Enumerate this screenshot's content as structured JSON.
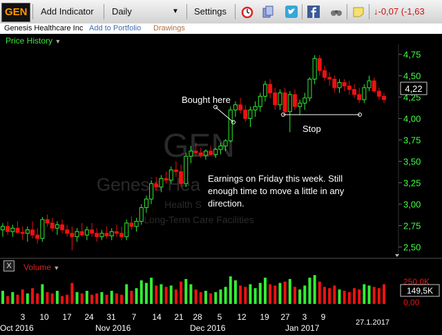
{
  "toolbar": {
    "symbol": "GEN",
    "add_indicator": "Add Indicator",
    "interval": "Daily",
    "interval_arrow": "▼",
    "settings": "Settings",
    "change": "↓-0,07 (-1,63"
  },
  "subbar": {
    "company": "Genesis Healthcare Inc",
    "add_portfolio": "Add to Portfolio",
    "drawings": "Drawings"
  },
  "price_panel": {
    "title": "Price History",
    "arrow": "▼"
  },
  "volume_panel": {
    "close_label": "X",
    "title": "Volume",
    "arrow": "▼"
  },
  "watermark": {
    "symbol": "GEN",
    "name": "Genesis Hea",
    "sector": "Health S",
    "industry": "Long-Term Care Facilities"
  },
  "annotations": {
    "bought": "Bought here",
    "stop": "Stop",
    "note": "Earnings on Friday this week. Still enough time to move a little in any direction."
  },
  "colors": {
    "up": "#33ee33",
    "down": "#ee1111",
    "accent": "#ff9800",
    "axis_text": "#44ff44"
  },
  "chart_data": {
    "type": "candlestick",
    "y_axis": {
      "ticks": [
        "4,75",
        "4,50",
        "4,25",
        "4,00",
        "3,75",
        "3,50",
        "3,25",
        "3,00",
        "2,75",
        "2,50"
      ],
      "range": [
        2.4,
        4.9
      ]
    },
    "last_price": "4,22",
    "volume_axis": {
      "ticks": [
        "250,0K",
        "0,00"
      ],
      "last": "149,5K"
    },
    "x_day_labels": [
      "3",
      "10",
      "17",
      "24",
      "31",
      "7",
      "14",
      "21",
      "28",
      "5",
      "12",
      "19",
      "27",
      "3",
      "9"
    ],
    "x_month_labels": [
      "Oct 2016",
      "Nov 2016",
      "Dec 2016",
      "Jan 2017"
    ],
    "date_label": "27.1.2017",
    "candles": [
      {
        "o": 2.7,
        "h": 2.78,
        "l": 2.62,
        "c": 2.74,
        "v": 100
      },
      {
        "o": 2.74,
        "h": 2.8,
        "l": 2.64,
        "c": 2.68,
        "v": 60
      },
      {
        "o": 2.68,
        "h": 2.76,
        "l": 2.62,
        "c": 2.72,
        "v": 90
      },
      {
        "o": 2.72,
        "h": 2.8,
        "l": 2.66,
        "c": 2.67,
        "v": 70
      },
      {
        "o": 2.67,
        "h": 2.74,
        "l": 2.58,
        "c": 2.66,
        "v": 110
      },
      {
        "o": 2.66,
        "h": 2.74,
        "l": 2.56,
        "c": 2.7,
        "v": 80
      },
      {
        "o": 2.7,
        "h": 2.8,
        "l": 2.6,
        "c": 2.64,
        "v": 120
      },
      {
        "o": 2.64,
        "h": 2.72,
        "l": 2.54,
        "c": 2.6,
        "v": 80
      },
      {
        "o": 2.6,
        "h": 2.85,
        "l": 2.56,
        "c": 2.82,
        "v": 150
      },
      {
        "o": 2.82,
        "h": 2.88,
        "l": 2.74,
        "c": 2.78,
        "v": 90
      },
      {
        "o": 2.78,
        "h": 2.84,
        "l": 2.68,
        "c": 2.72,
        "v": 80
      },
      {
        "o": 2.72,
        "h": 2.8,
        "l": 2.64,
        "c": 2.76,
        "v": 100
      },
      {
        "o": 2.76,
        "h": 2.82,
        "l": 2.66,
        "c": 2.7,
        "v": 60
      },
      {
        "o": 2.7,
        "h": 2.76,
        "l": 2.62,
        "c": 2.66,
        "v": 70
      },
      {
        "o": 2.66,
        "h": 2.74,
        "l": 2.46,
        "c": 2.62,
        "v": 160
      },
      {
        "o": 2.62,
        "h": 2.72,
        "l": 2.56,
        "c": 2.68,
        "v": 90
      },
      {
        "o": 2.68,
        "h": 2.78,
        "l": 2.62,
        "c": 2.64,
        "v": 80
      },
      {
        "o": 2.64,
        "h": 2.74,
        "l": 2.58,
        "c": 2.7,
        "v": 100
      },
      {
        "o": 2.7,
        "h": 2.78,
        "l": 2.62,
        "c": 2.66,
        "v": 70
      },
      {
        "o": 2.66,
        "h": 2.72,
        "l": 2.56,
        "c": 2.62,
        "v": 80
      },
      {
        "o": 2.62,
        "h": 2.7,
        "l": 2.58,
        "c": 2.66,
        "v": 90
      },
      {
        "o": 2.66,
        "h": 2.74,
        "l": 2.6,
        "c": 2.63,
        "v": 70
      },
      {
        "o": 2.63,
        "h": 2.72,
        "l": 2.58,
        "c": 2.68,
        "v": 100
      },
      {
        "o": 2.68,
        "h": 2.76,
        "l": 2.62,
        "c": 2.66,
        "v": 80
      },
      {
        "o": 2.66,
        "h": 2.74,
        "l": 2.58,
        "c": 2.62,
        "v": 70
      },
      {
        "o": 2.62,
        "h": 2.82,
        "l": 2.58,
        "c": 2.78,
        "v": 150
      },
      {
        "o": 2.78,
        "h": 2.86,
        "l": 2.7,
        "c": 2.74,
        "v": 100
      },
      {
        "o": 2.74,
        "h": 2.84,
        "l": 2.68,
        "c": 2.8,
        "v": 120
      },
      {
        "o": 2.8,
        "h": 3.0,
        "l": 2.76,
        "c": 2.96,
        "v": 180
      },
      {
        "o": 2.96,
        "h": 3.1,
        "l": 2.9,
        "c": 3.06,
        "v": 160
      },
      {
        "o": 3.06,
        "h": 3.28,
        "l": 3.0,
        "c": 3.24,
        "v": 200
      },
      {
        "o": 3.24,
        "h": 3.32,
        "l": 3.16,
        "c": 3.2,
        "v": 140
      },
      {
        "o": 3.2,
        "h": 3.34,
        "l": 3.14,
        "c": 3.3,
        "v": 150
      },
      {
        "o": 3.3,
        "h": 3.38,
        "l": 3.24,
        "c": 3.28,
        "v": 130
      },
      {
        "o": 3.28,
        "h": 3.44,
        "l": 3.24,
        "c": 3.4,
        "v": 140
      },
      {
        "o": 3.4,
        "h": 3.5,
        "l": 3.32,
        "c": 3.38,
        "v": 110
      },
      {
        "o": 3.38,
        "h": 3.46,
        "l": 3.2,
        "c": 3.24,
        "v": 170
      },
      {
        "o": 3.24,
        "h": 3.6,
        "l": 3.2,
        "c": 3.56,
        "v": 190
      },
      {
        "o": 3.56,
        "h": 3.68,
        "l": 3.48,
        "c": 3.62,
        "v": 150
      },
      {
        "o": 3.62,
        "h": 3.72,
        "l": 3.56,
        "c": 3.6,
        "v": 110
      },
      {
        "o": 3.6,
        "h": 3.66,
        "l": 3.54,
        "c": 3.57,
        "v": 90
      },
      {
        "o": 3.57,
        "h": 3.64,
        "l": 3.52,
        "c": 3.62,
        "v": 100
      },
      {
        "o": 3.62,
        "h": 3.68,
        "l": 3.56,
        "c": 3.58,
        "v": 80
      },
      {
        "o": 3.58,
        "h": 3.66,
        "l": 3.54,
        "c": 3.64,
        "v": 90
      },
      {
        "o": 3.64,
        "h": 3.72,
        "l": 3.58,
        "c": 3.68,
        "v": 110
      },
      {
        "o": 3.68,
        "h": 3.76,
        "l": 3.62,
        "c": 3.74,
        "v": 130
      },
      {
        "o": 3.74,
        "h": 4.14,
        "l": 3.72,
        "c": 4.1,
        "v": 210
      },
      {
        "o": 4.1,
        "h": 4.2,
        "l": 4.02,
        "c": 4.16,
        "v": 180
      },
      {
        "o": 4.16,
        "h": 4.24,
        "l": 4.06,
        "c": 4.1,
        "v": 140
      },
      {
        "o": 4.1,
        "h": 4.16,
        "l": 3.96,
        "c": 4.0,
        "v": 130
      },
      {
        "o": 4.0,
        "h": 4.14,
        "l": 3.9,
        "c": 4.1,
        "v": 150
      },
      {
        "o": 4.1,
        "h": 4.2,
        "l": 4.02,
        "c": 4.14,
        "v": 120
      },
      {
        "o": 4.14,
        "h": 4.3,
        "l": 4.08,
        "c": 4.26,
        "v": 160
      },
      {
        "o": 4.26,
        "h": 4.44,
        "l": 4.2,
        "c": 4.4,
        "v": 200
      },
      {
        "o": 4.4,
        "h": 4.46,
        "l": 4.24,
        "c": 4.3,
        "v": 150
      },
      {
        "o": 4.3,
        "h": 4.36,
        "l": 4.1,
        "c": 4.16,
        "v": 140
      },
      {
        "o": 4.16,
        "h": 4.34,
        "l": 4.1,
        "c": 4.3,
        "v": 160
      },
      {
        "o": 4.3,
        "h": 4.36,
        "l": 4.04,
        "c": 4.08,
        "v": 170
      },
      {
        "o": 4.08,
        "h": 4.32,
        "l": 3.84,
        "c": 4.28,
        "v": 190
      },
      {
        "o": 4.28,
        "h": 4.34,
        "l": 4.1,
        "c": 4.14,
        "v": 130
      },
      {
        "o": 4.14,
        "h": 4.22,
        "l": 4.04,
        "c": 4.18,
        "v": 110
      },
      {
        "o": 4.18,
        "h": 4.3,
        "l": 4.1,
        "c": 4.24,
        "v": 140
      },
      {
        "o": 4.24,
        "h": 4.48,
        "l": 4.2,
        "c": 4.46,
        "v": 200
      },
      {
        "o": 4.46,
        "h": 4.74,
        "l": 4.4,
        "c": 4.7,
        "v": 220
      },
      {
        "o": 4.7,
        "h": 4.74,
        "l": 4.5,
        "c": 4.56,
        "v": 170
      },
      {
        "o": 4.56,
        "h": 4.62,
        "l": 4.44,
        "c": 4.48,
        "v": 130
      },
      {
        "o": 4.48,
        "h": 4.54,
        "l": 4.38,
        "c": 4.46,
        "v": 120
      },
      {
        "o": 4.46,
        "h": 4.5,
        "l": 4.3,
        "c": 4.36,
        "v": 140
      },
      {
        "o": 4.36,
        "h": 4.46,
        "l": 4.3,
        "c": 4.42,
        "v": 110
      },
      {
        "o": 4.42,
        "h": 4.46,
        "l": 4.32,
        "c": 4.38,
        "v": 100
      },
      {
        "o": 4.38,
        "h": 4.44,
        "l": 4.28,
        "c": 4.34,
        "v": 90
      },
      {
        "o": 4.34,
        "h": 4.4,
        "l": 4.24,
        "c": 4.28,
        "v": 120
      },
      {
        "o": 4.28,
        "h": 4.36,
        "l": 4.18,
        "c": 4.22,
        "v": 110
      },
      {
        "o": 4.22,
        "h": 4.4,
        "l": 4.18,
        "c": 4.36,
        "v": 150
      },
      {
        "o": 4.36,
        "h": 4.5,
        "l": 4.32,
        "c": 4.44,
        "v": 140
      },
      {
        "o": 4.44,
        "h": 4.48,
        "l": 4.3,
        "c": 4.32,
        "v": 130
      },
      {
        "o": 4.32,
        "h": 4.36,
        "l": 4.22,
        "c": 4.26,
        "v": 120
      },
      {
        "o": 4.26,
        "h": 4.3,
        "l": 4.18,
        "c": 4.22,
        "v": 150
      }
    ]
  }
}
